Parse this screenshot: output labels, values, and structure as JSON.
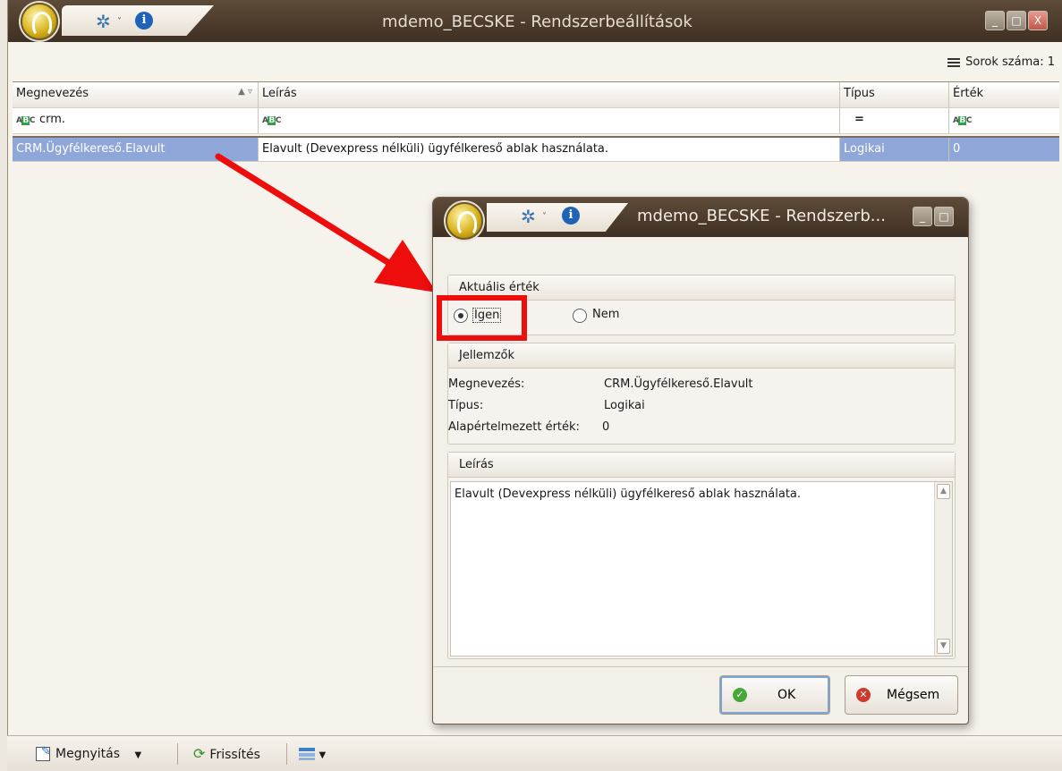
{
  "window": {
    "title": "mdemo_BECSKE - Rendszerbeállítások",
    "minimize_glyph": "_",
    "maximize_glyph": "□",
    "close_glyph": "X"
  },
  "rows_count": {
    "label": "Sorok száma: 1"
  },
  "grid": {
    "columns": [
      "Megnevezés",
      "Leírás",
      "Típus",
      "Érték"
    ],
    "filter": {
      "name": "crm.",
      "type": "="
    },
    "rows": [
      {
        "name": "CRM.Ügyfélkereső.Elavult",
        "description": "Elavult (Devexpress nélküli) ügyfélkereső ablak használata.",
        "type": "Logikai",
        "value": "0"
      }
    ]
  },
  "bottom_toolbar": {
    "open_label": "Megnyitás",
    "refresh_label": "Frissítés"
  },
  "dialog": {
    "title": "mdemo_BECSKE - Rendszerb...",
    "current_value": {
      "header": "Aktuális érték",
      "yes_label": "Igen",
      "no_label": "Nem",
      "selected": "Igen"
    },
    "properties": {
      "header": "Jellemzők",
      "name_label": "Megnevezés:",
      "name_value": "CRM.Ügyfélkereső.Elavult",
      "type_label": "Típus:",
      "type_value": "Logikai",
      "default_label": "Alapértelmezett érték:",
      "default_value": "0"
    },
    "description": {
      "header": "Leírás",
      "text": "Elavult (Devexpress nélküli) ügyfélkereső ablak használata."
    },
    "ok_label": "OK",
    "cancel_label": "Mégsem"
  },
  "colors": {
    "selection": "#8fa6d9",
    "annotation_red": "#ee0d0d",
    "title_bar": "#4b3b2c"
  }
}
